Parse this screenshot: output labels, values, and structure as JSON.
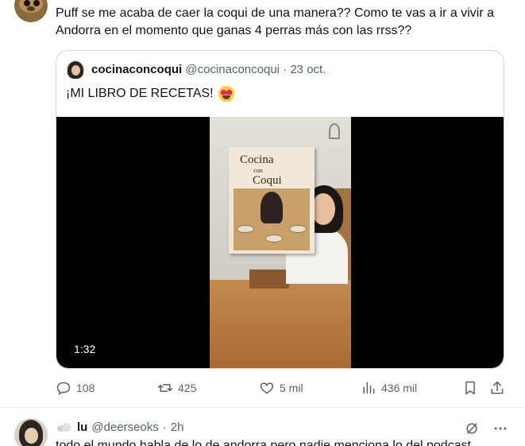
{
  "tweet": {
    "text": "Puff se me acaba de caer la coqui de una manera?? Como te vas a ir a vivir a Andorra en el momento que ganas 4 perras más con las rrss??"
  },
  "quote": {
    "name": "cocinaconcoqui",
    "handle": "@cocinaconcoqui",
    "separator": "·",
    "date": "23 oct.",
    "text": "¡MI LIBRO DE RECETAS!",
    "emoji": "smiling-face-with-heart-eyes",
    "video": {
      "duration": "1:32",
      "book_title": "Cocina",
      "book_title_small": "con",
      "book_title_2": "Coqui"
    }
  },
  "actions": {
    "replies": "108",
    "retweets": "425",
    "likes": "5 mil",
    "views": "436 mil"
  },
  "reply": {
    "name": "lu",
    "handle": "@deerseoks",
    "separator": "·",
    "time": "2h",
    "text": "todo el mundo habla de lo de andorra pero nadie menciona lo del podcast"
  },
  "colors": {
    "text": "#0f1419",
    "secondary": "#536471",
    "border": "#cfd9de"
  }
}
